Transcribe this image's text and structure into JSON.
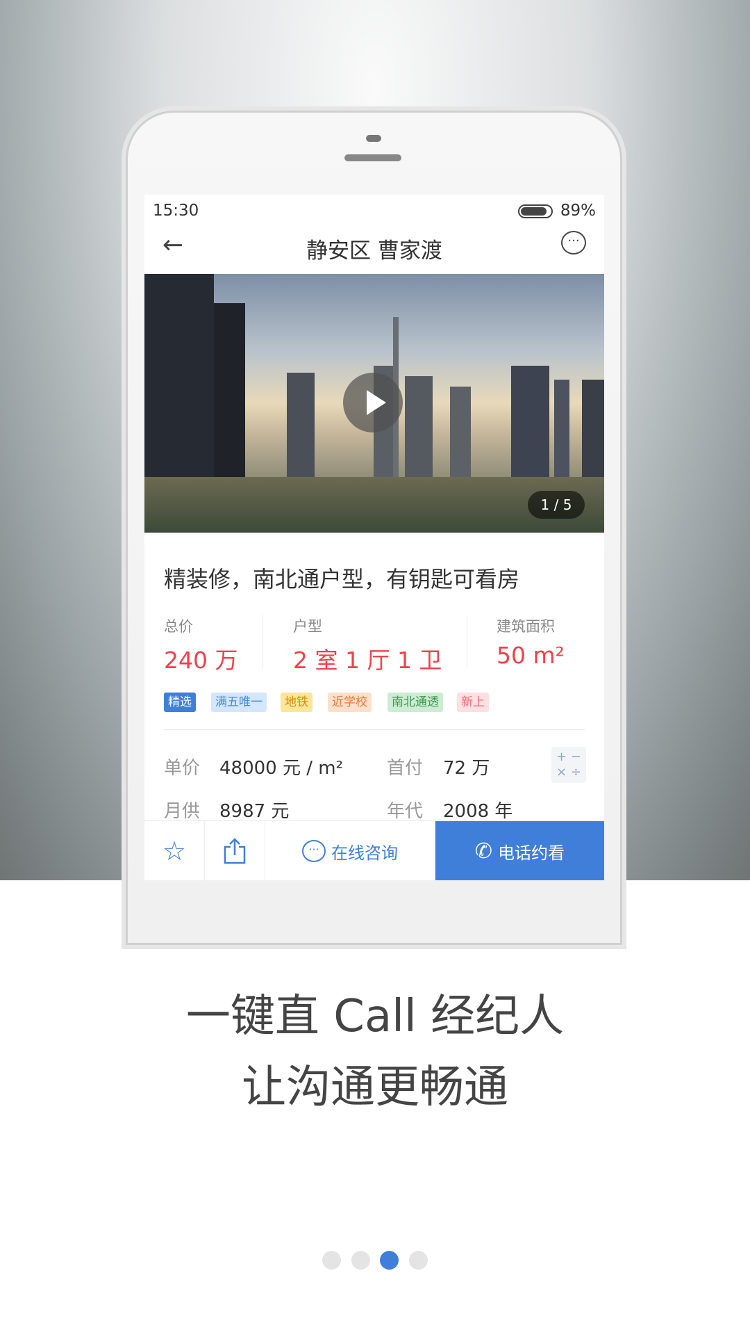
{
  "status_bar": {
    "time": "15:30",
    "battery": "89%",
    "battery_level": 89
  },
  "header": {
    "title": "静安区 曹家渡",
    "back_icon": "arrow-left-icon",
    "chat_icon": "chat-bubble-icon"
  },
  "gallery": {
    "counter": "1 / 5",
    "play_icon": "play-icon"
  },
  "listing": {
    "title": "精装修，南北通户型，有钥匙可看房",
    "stats": [
      {
        "label": "总价",
        "value": "240 万"
      },
      {
        "label": "户型",
        "value": "2 室 1 厅 1 卫"
      },
      {
        "label": "建筑面积",
        "value": "50 m²"
      }
    ],
    "tags": [
      {
        "text": "精选",
        "bg": "#3f7fd9",
        "fg": "#ffffff"
      },
      {
        "text": "满五唯一",
        "bg": "#d4e6fb",
        "fg": "#4a8ad8"
      },
      {
        "text": "地铁",
        "bg": "#fde59a",
        "fg": "#d58a10"
      },
      {
        "text": "近学校",
        "bg": "#fde0cc",
        "fg": "#e57a3a"
      },
      {
        "text": "南北通透",
        "bg": "#cdecd3",
        "fg": "#3b9a52"
      },
      {
        "text": "新上",
        "bg": "#fde0e2",
        "fg": "#ef6a75"
      }
    ],
    "details": [
      {
        "label": "单价",
        "value": "48000 元 / m²"
      },
      {
        "label": "首付",
        "value": "72 万"
      },
      {
        "label": "月供",
        "value": "8987 元"
      },
      {
        "label": "年代",
        "value": "2008 年"
      }
    ],
    "calculator_icon": "calculator-icon"
  },
  "action_bar": {
    "favorite_icon": "star-icon",
    "share_icon": "share-icon",
    "consult_label": "在线咨询",
    "call_label": "电话约看",
    "accent": "#3f7fd9"
  },
  "promo": {
    "line1": "一键直 Call 经纪人",
    "line2": "让沟通更畅通"
  },
  "pager": {
    "count": 4,
    "active": 3
  }
}
